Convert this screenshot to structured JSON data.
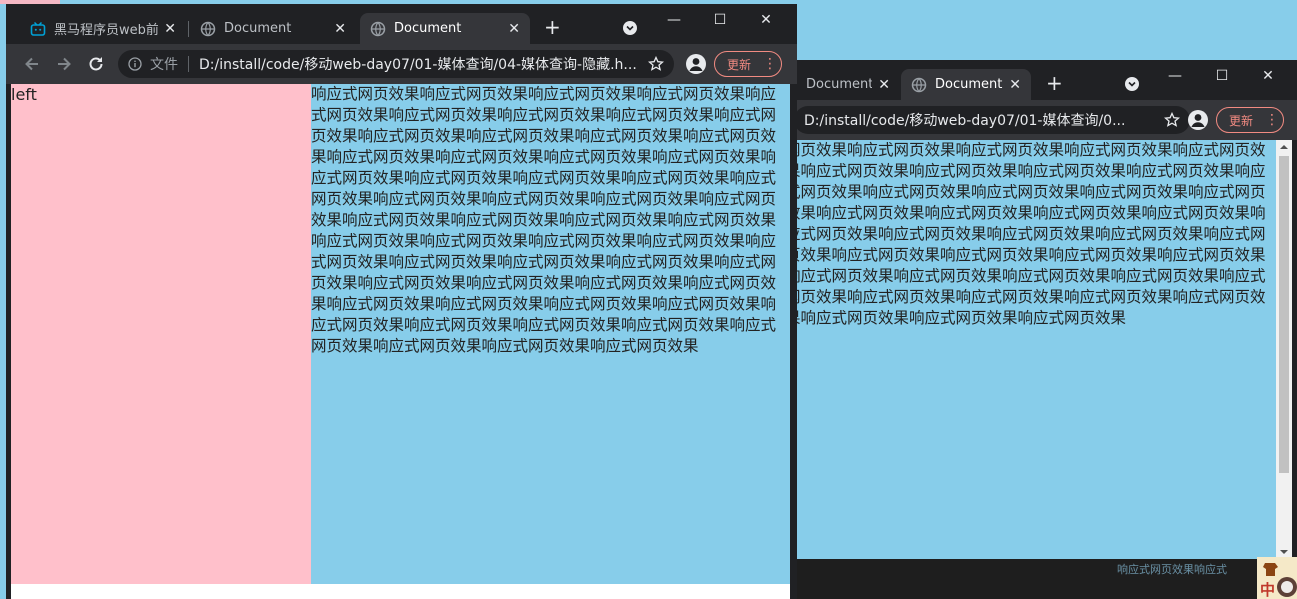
{
  "window_a": {
    "tabs": [
      {
        "title": "黑马程序员web前端",
        "close": "✕",
        "active": false
      },
      {
        "title": "Document",
        "close": "✕",
        "active": false
      },
      {
        "title": "Document",
        "close": "✕",
        "active": true
      }
    ],
    "new_tab": "+",
    "controls": {
      "minimize": "—",
      "maximize": "☐",
      "close": "✕"
    },
    "omnibox": {
      "scheme_label": "文件",
      "url": "D:/install/code/移动web-day07/01-媒体查询/04-媒体查询-隐藏.h..."
    },
    "update_label": "更新",
    "menu_dots": "⋮",
    "page": {
      "left_text": "left",
      "right_text": "响应式网页效果响应式网页效果响应式网页效果响应式网页效果响应式网页效果响应式网页效果响应式网页效果响应式网页效果响应式网页效果响应式网页效果响应式网页效果响应式网页效果响应式网页效果响应式网页效果响应式网页效果响应式网页效果响应式网页效果响应式网页效果响应式网页效果响应式网页效果响应式网页效果响应式网页效果响应式网页效果响应式网页效果响应式网页效果响应式网页效果响应式网页效果响应式网页效果响应式网页效果响应式网页效果响应式网页效果响应式网页效果响应式网页效果响应式网页效果响应式网页效果响应式网页效果响应式网页效果响应式网页效果响应式网页效果响应式网页效果响应式网页效果响应式网页效果响应式网页效果响应式网页效果响应式网页效果响应式网页效果响应式网页效果响应式网页效果响应式网页效果响应式网页效果响应式网页效果响应式网页效果响应式网页效果响应式网页效果响应式网页效果"
    }
  },
  "window_b": {
    "tabs": [
      {
        "title": "Document",
        "close": "✕",
        "active": false
      },
      {
        "title": "Document",
        "close": "✕",
        "active": true
      }
    ],
    "new_tab": "+",
    "controls": {
      "minimize": "—",
      "maximize": "☐",
      "close": "✕"
    },
    "omnibox": {
      "url": "D:/install/code/移动web-day07/01-媒体查询/0..."
    },
    "update_label": "更新",
    "menu_dots": "⋮",
    "page_text": "网页效果响应式网页效果响应式网页效果响应式网页效果响应式网页效果响应式网页效果响应式网页效果响应式网页效果响应式网页效果响应式网页效果响应式网页效果响应式网页效果响应式网页效果响应式网页效果响应式网页效果响应式网页效果响应式网页效果响应式网页效果响应式网页效果响应式网页效果响应式网页效果响应式网页效果响应式网页效果响应式网页效果响应式网页效果响应式网页效果响应式网页效果响应式网页效果响应式网页效果响应式网页效果响应式网页效果响应式网页效果响应式网页效果响应式网页效果响应式网页效果响应式网页效果响应式网页效果响应式网页效果响应式网页效果"
  },
  "background_editor_text": "响应式网页效果响应式",
  "ime_glyph": "中",
  "colors": {
    "pink": "#ffc0cb",
    "skyblue": "#87cdea",
    "chrome_dark": "#202124",
    "chrome_toolbar": "#35363a",
    "update_accent": "#f28b82"
  }
}
